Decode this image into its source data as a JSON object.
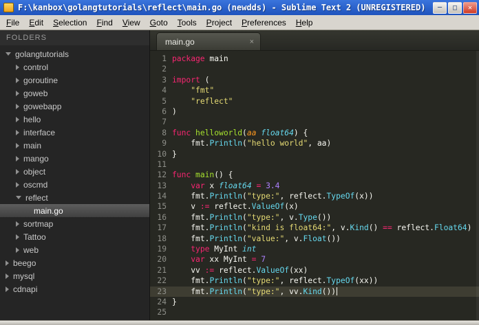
{
  "window": {
    "title": "F:\\kanbox\\golangtutorials\\reflect\\main.go (newdds) - Sublime Text 2 (UNREGISTERED)",
    "controls": {
      "minimize": "─",
      "maximize": "□",
      "close": "✕"
    }
  },
  "menu_bar": {
    "items": [
      "File",
      "Edit",
      "Selection",
      "Find",
      "View",
      "Goto",
      "Tools",
      "Project",
      "Preferences",
      "Help"
    ]
  },
  "sidebar": {
    "header": "FOLDERS",
    "items": [
      {
        "label": "golangtutorials",
        "depth": 0,
        "type": "folder",
        "state": "expanded"
      },
      {
        "label": "control",
        "depth": 1,
        "type": "folder",
        "state": "collapsed"
      },
      {
        "label": "goroutine",
        "depth": 1,
        "type": "folder",
        "state": "collapsed"
      },
      {
        "label": "goweb",
        "depth": 1,
        "type": "folder",
        "state": "collapsed"
      },
      {
        "label": "gowebapp",
        "depth": 1,
        "type": "folder",
        "state": "collapsed"
      },
      {
        "label": "hello",
        "depth": 1,
        "type": "folder",
        "state": "collapsed"
      },
      {
        "label": "interface",
        "depth": 1,
        "type": "folder",
        "state": "collapsed"
      },
      {
        "label": "main",
        "depth": 1,
        "type": "folder",
        "state": "collapsed"
      },
      {
        "label": "mango",
        "depth": 1,
        "type": "folder",
        "state": "collapsed"
      },
      {
        "label": "object",
        "depth": 1,
        "type": "folder",
        "state": "collapsed"
      },
      {
        "label": "oscmd",
        "depth": 1,
        "type": "folder",
        "state": "collapsed"
      },
      {
        "label": "reflect",
        "depth": 1,
        "type": "folder",
        "state": "expanded"
      },
      {
        "label": "main.go",
        "depth": 2,
        "type": "file",
        "selected": true
      },
      {
        "label": "sortmap",
        "depth": 1,
        "type": "folder",
        "state": "collapsed"
      },
      {
        "label": "Tattoo",
        "depth": 1,
        "type": "folder",
        "state": "collapsed"
      },
      {
        "label": "web",
        "depth": 1,
        "type": "folder",
        "state": "collapsed"
      },
      {
        "label": "beego",
        "depth": 0,
        "type": "folder",
        "state": "collapsed"
      },
      {
        "label": "mysql",
        "depth": 0,
        "type": "folder",
        "state": "collapsed"
      },
      {
        "label": "cdnapi",
        "depth": 0,
        "type": "folder",
        "state": "collapsed"
      }
    ]
  },
  "editor": {
    "tab": {
      "label": "main.go",
      "close_glyph": "×"
    },
    "lines": [
      {
        "n": 1,
        "indent": 0,
        "tokens": [
          [
            "kw",
            "package"
          ],
          [
            "plain",
            " main"
          ]
        ]
      },
      {
        "n": 2,
        "indent": 0,
        "tokens": []
      },
      {
        "n": 3,
        "indent": 0,
        "tokens": [
          [
            "kw",
            "import"
          ],
          [
            "plain",
            " ("
          ]
        ]
      },
      {
        "n": 4,
        "indent": 1,
        "tokens": [
          [
            "str",
            "\"fmt\""
          ]
        ]
      },
      {
        "n": 5,
        "indent": 1,
        "tokens": [
          [
            "str",
            "\"reflect\""
          ]
        ]
      },
      {
        "n": 6,
        "indent": 0,
        "tokens": [
          [
            "plain",
            ")"
          ]
        ]
      },
      {
        "n": 7,
        "indent": 0,
        "tokens": []
      },
      {
        "n": 8,
        "indent": 0,
        "tokens": [
          [
            "kw",
            "func"
          ],
          [
            "plain",
            " "
          ],
          [
            "fn",
            "helloworld"
          ],
          [
            "plain",
            "("
          ],
          [
            "param",
            "aa"
          ],
          [
            "plain",
            " "
          ],
          [
            "type",
            "float64"
          ],
          [
            "plain",
            ") {"
          ]
        ]
      },
      {
        "n": 9,
        "indent": 1,
        "tokens": [
          [
            "plain",
            "fmt."
          ],
          [
            "call",
            "Println"
          ],
          [
            "plain",
            "("
          ],
          [
            "str",
            "\"hello world\""
          ],
          [
            "plain",
            ", aa)"
          ]
        ]
      },
      {
        "n": 10,
        "indent": 0,
        "tokens": [
          [
            "plain",
            "}"
          ]
        ]
      },
      {
        "n": 11,
        "indent": 0,
        "tokens": []
      },
      {
        "n": 12,
        "indent": 0,
        "tokens": [
          [
            "kw",
            "func"
          ],
          [
            "plain",
            " "
          ],
          [
            "fn",
            "main"
          ],
          [
            "plain",
            "() {"
          ]
        ]
      },
      {
        "n": 13,
        "indent": 1,
        "tokens": [
          [
            "kw",
            "var"
          ],
          [
            "plain",
            " x "
          ],
          [
            "type",
            "float64"
          ],
          [
            "plain",
            " "
          ],
          [
            "op",
            "="
          ],
          [
            "plain",
            " "
          ],
          [
            "num",
            "3.4"
          ]
        ]
      },
      {
        "n": 14,
        "indent": 1,
        "tokens": [
          [
            "plain",
            "fmt."
          ],
          [
            "call",
            "Println"
          ],
          [
            "plain",
            "("
          ],
          [
            "str",
            "\"type:\""
          ],
          [
            "plain",
            ", reflect."
          ],
          [
            "call",
            "TypeOf"
          ],
          [
            "plain",
            "(x))"
          ]
        ]
      },
      {
        "n": 15,
        "indent": 1,
        "tokens": [
          [
            "plain",
            "v "
          ],
          [
            "op",
            ":="
          ],
          [
            "plain",
            " reflect."
          ],
          [
            "call",
            "ValueOf"
          ],
          [
            "plain",
            "(x)"
          ]
        ]
      },
      {
        "n": 16,
        "indent": 1,
        "tokens": [
          [
            "plain",
            "fmt."
          ],
          [
            "call",
            "Println"
          ],
          [
            "plain",
            "("
          ],
          [
            "str",
            "\"type:\""
          ],
          [
            "plain",
            ", v."
          ],
          [
            "call",
            "Type"
          ],
          [
            "plain",
            "())"
          ]
        ]
      },
      {
        "n": 17,
        "indent": 1,
        "tokens": [
          [
            "plain",
            "fmt."
          ],
          [
            "call",
            "Println"
          ],
          [
            "plain",
            "("
          ],
          [
            "str",
            "\"kind is float64:\""
          ],
          [
            "plain",
            ", v."
          ],
          [
            "call",
            "Kind"
          ],
          [
            "plain",
            "() "
          ],
          [
            "op",
            "=="
          ],
          [
            "plain",
            " reflect."
          ],
          [
            "call",
            "Float64"
          ],
          [
            "plain",
            ")"
          ]
        ]
      },
      {
        "n": 18,
        "indent": 1,
        "tokens": [
          [
            "plain",
            "fmt."
          ],
          [
            "call",
            "Println"
          ],
          [
            "plain",
            "("
          ],
          [
            "str",
            "\"value:\""
          ],
          [
            "plain",
            ", v."
          ],
          [
            "call",
            "Float"
          ],
          [
            "plain",
            "())"
          ]
        ]
      },
      {
        "n": 19,
        "indent": 1,
        "tokens": [
          [
            "kw",
            "type"
          ],
          [
            "plain",
            " MyInt "
          ],
          [
            "type",
            "int"
          ]
        ]
      },
      {
        "n": 20,
        "indent": 1,
        "tokens": [
          [
            "kw",
            "var"
          ],
          [
            "plain",
            " xx MyInt "
          ],
          [
            "op",
            "="
          ],
          [
            "plain",
            " "
          ],
          [
            "num",
            "7"
          ]
        ]
      },
      {
        "n": 21,
        "indent": 1,
        "tokens": [
          [
            "plain",
            "vv "
          ],
          [
            "op",
            ":="
          ],
          [
            "plain",
            " reflect."
          ],
          [
            "call",
            "ValueOf"
          ],
          [
            "plain",
            "(xx)"
          ]
        ]
      },
      {
        "n": 22,
        "indent": 1,
        "tokens": [
          [
            "plain",
            "fmt."
          ],
          [
            "call",
            "Println"
          ],
          [
            "plain",
            "("
          ],
          [
            "str",
            "\"type:\""
          ],
          [
            "plain",
            ", reflect."
          ],
          [
            "call",
            "TypeOf"
          ],
          [
            "plain",
            "(xx))"
          ]
        ]
      },
      {
        "n": 23,
        "indent": 1,
        "current": true,
        "cursor": true,
        "tokens": [
          [
            "plain",
            "fmt."
          ],
          [
            "call",
            "Println"
          ],
          [
            "plain",
            "("
          ],
          [
            "str",
            "\"type:\""
          ],
          [
            "plain",
            ", vv."
          ],
          [
            "call",
            "Kind"
          ],
          [
            "plain",
            "())"
          ]
        ]
      },
      {
        "n": 24,
        "indent": 0,
        "tokens": [
          [
            "plain",
            "}"
          ]
        ]
      },
      {
        "n": 25,
        "indent": 0,
        "tokens": []
      }
    ]
  },
  "colors": {
    "editor_background": "#272822",
    "current_line": "#3e3d32",
    "keyword": "#f92672",
    "string": "#e6db74",
    "number": "#ae81ff",
    "type": "#66d9ef",
    "function_name": "#a6e22e",
    "parameter": "#fd971f",
    "line_number": "#8f908a",
    "titlebar_blue": "#2a63cf"
  }
}
